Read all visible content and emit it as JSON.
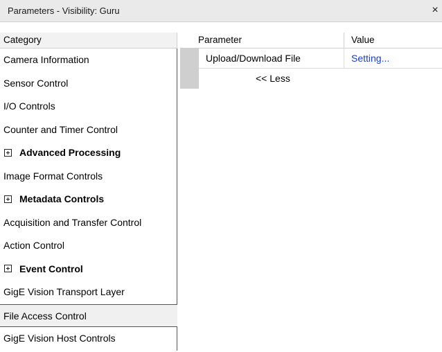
{
  "window": {
    "title": "Parameters - Visibility: Guru",
    "close_glyph": "×"
  },
  "headers": {
    "category": "Category",
    "parameter": "Parameter",
    "value": "Value"
  },
  "categories": [
    {
      "label": "Camera Information",
      "group": false
    },
    {
      "label": "Sensor Control",
      "group": false
    },
    {
      "label": "I/O Controls",
      "group": false
    },
    {
      "label": "Counter and Timer Control",
      "group": false
    },
    {
      "label": "Advanced Processing",
      "group": true
    },
    {
      "label": "Image Format Controls",
      "group": false
    },
    {
      "label": "Metadata Controls",
      "group": true
    },
    {
      "label": "Acquisition and Transfer Control",
      "group": false
    },
    {
      "label": "Action Control",
      "group": false
    },
    {
      "label": "Event Control",
      "group": true
    },
    {
      "label": "GigE Vision Transport Layer",
      "group": false
    },
    {
      "label": "File Access Control",
      "group": false,
      "selected": true
    },
    {
      "label": "GigE Vision Host Controls",
      "group": false
    }
  ],
  "parameters": [
    {
      "name": "Upload/Download File",
      "value": "Setting..."
    }
  ],
  "less_label": "<< Less",
  "icons": {
    "expander": "plus-box-icon",
    "close": "close-icon"
  },
  "colors": {
    "value_link": "#1a3ccc",
    "selected_row": "#f0f0f0",
    "gutter": "#cfcfcf"
  }
}
